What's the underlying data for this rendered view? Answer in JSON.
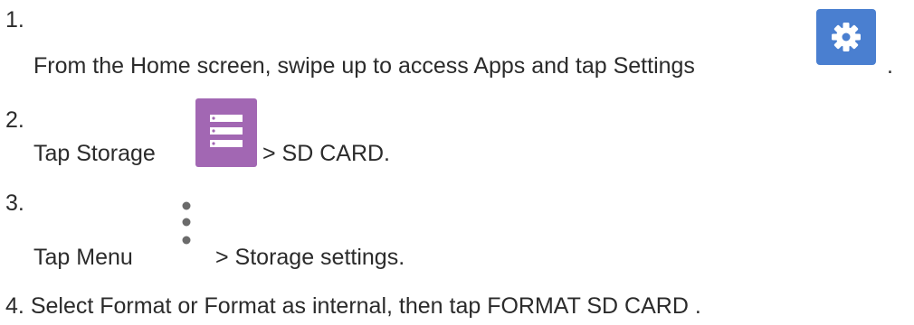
{
  "steps": [
    {
      "number": "1.",
      "text_before": "From the Home screen, swipe up to access Apps and tap Settings",
      "icon": "settings-gear-icon",
      "icon_color": "#4a7fd0",
      "text_after": "."
    },
    {
      "number": "2.",
      "text_before": "Tap Storage",
      "icon": "storage-icon",
      "icon_color": "#a267b3",
      "text_after": "> SD CARD."
    },
    {
      "number": "3.",
      "text_before": "Tap Menu",
      "icon": "menu-vertical-dots-icon",
      "icon_color": "#6b6b6b",
      "text_after": "> Storage settings."
    },
    {
      "number": "4.",
      "text": "Select Format or Format as internal, then tap FORMAT SD CARD ."
    }
  ]
}
